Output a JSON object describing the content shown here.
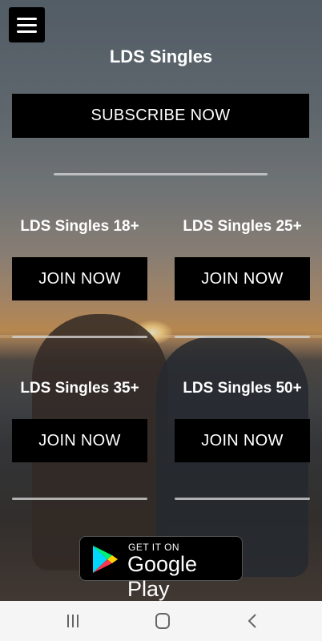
{
  "header": {
    "title": "LDS Singles"
  },
  "subscribe": {
    "label": "SUBSCRIBE NOW"
  },
  "groups": [
    {
      "title": "LDS Singles 18+",
      "button": "JOIN NOW"
    },
    {
      "title": "LDS Singles 25+",
      "button": "JOIN NOW"
    },
    {
      "title": "LDS Singles 35+",
      "button": "JOIN NOW"
    },
    {
      "title": "LDS Singles 50+",
      "button": "JOIN NOW"
    }
  ],
  "google_play": {
    "small": "GET IT ON",
    "big": "Google Play"
  },
  "icons": {
    "menu": "hamburger-menu-icon",
    "play_logo": "google-play-logo",
    "nav": [
      "recent-apps-icon",
      "home-icon",
      "back-icon"
    ]
  }
}
